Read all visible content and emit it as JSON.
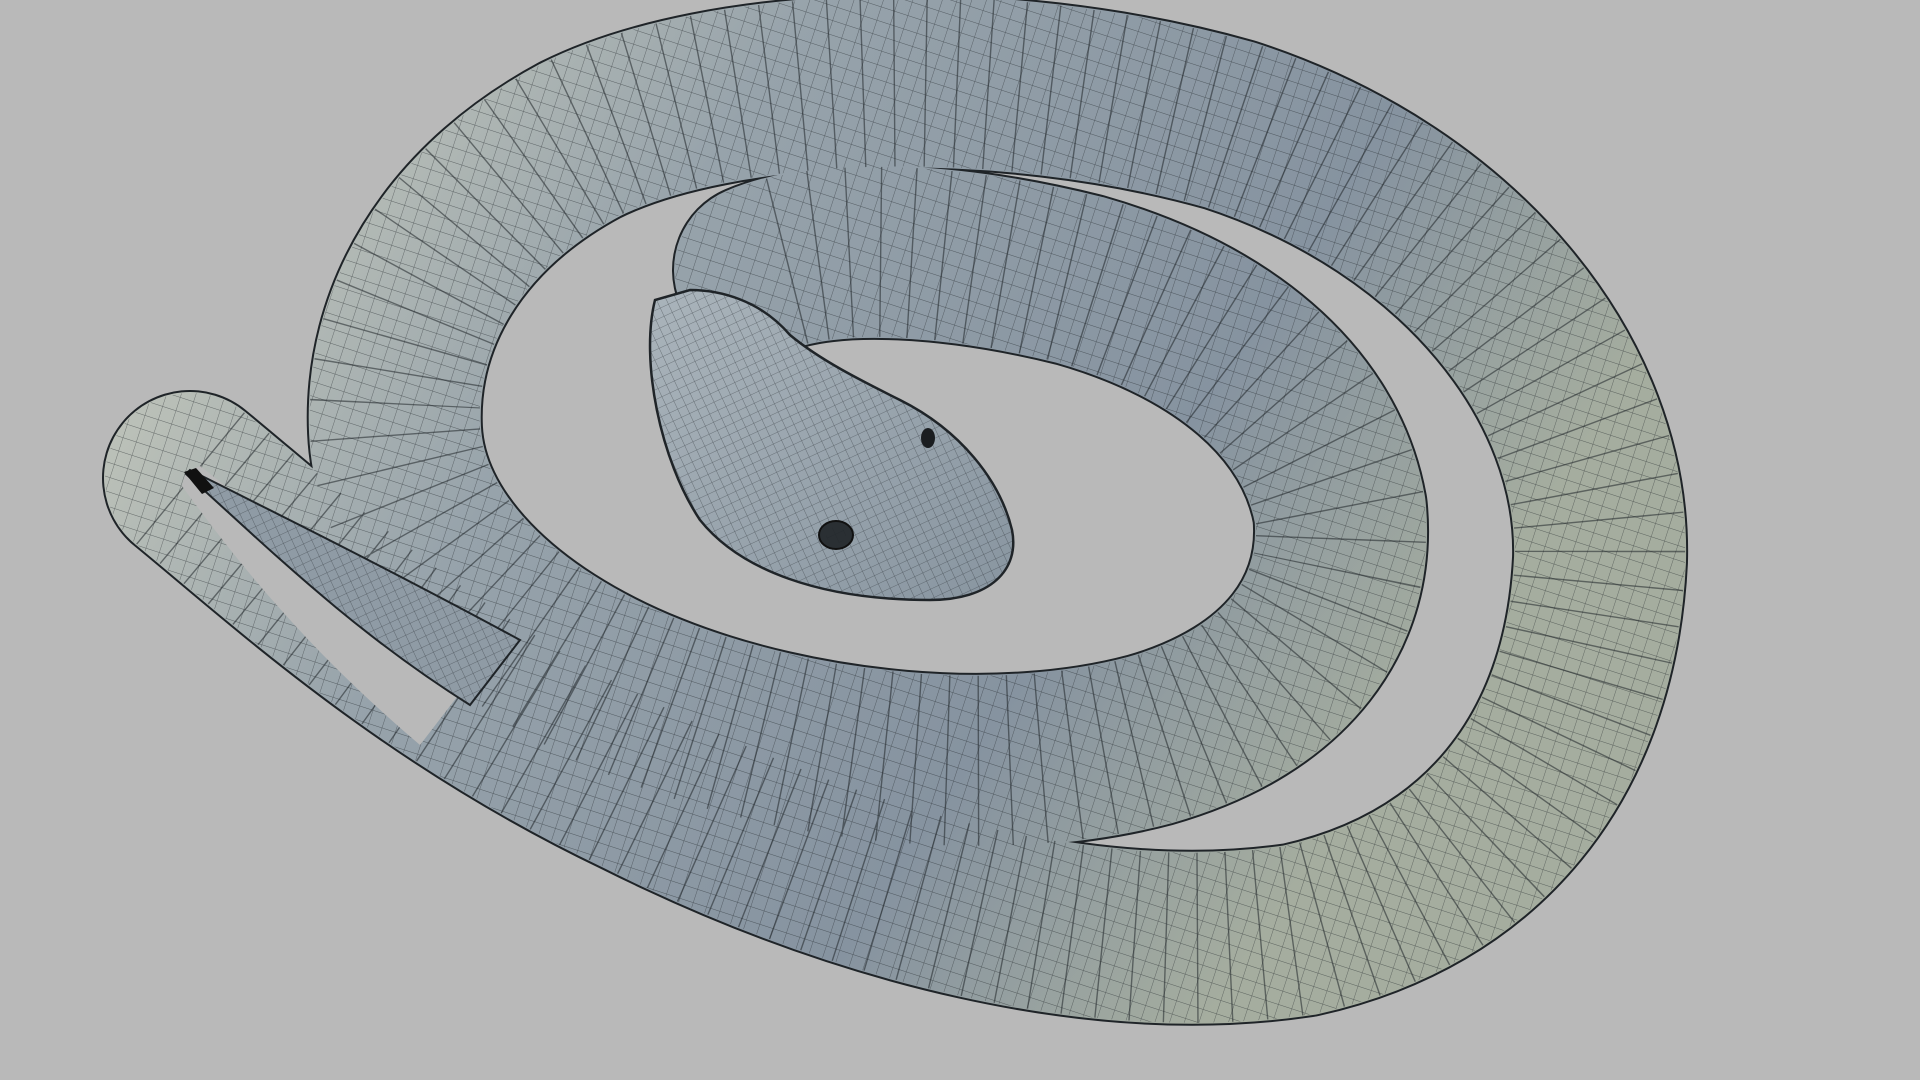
{
  "scene": {
    "subject": "coiled-snake-mesh",
    "render_style": "wireframe-on-shaded",
    "colors": {
      "background": "#b9b9b9",
      "body_base": "#8e9aa3",
      "body_light": "#d9dccb",
      "body_shadow": "#6f7b84",
      "wire": "#1f2428",
      "eye": "#111111"
    }
  }
}
